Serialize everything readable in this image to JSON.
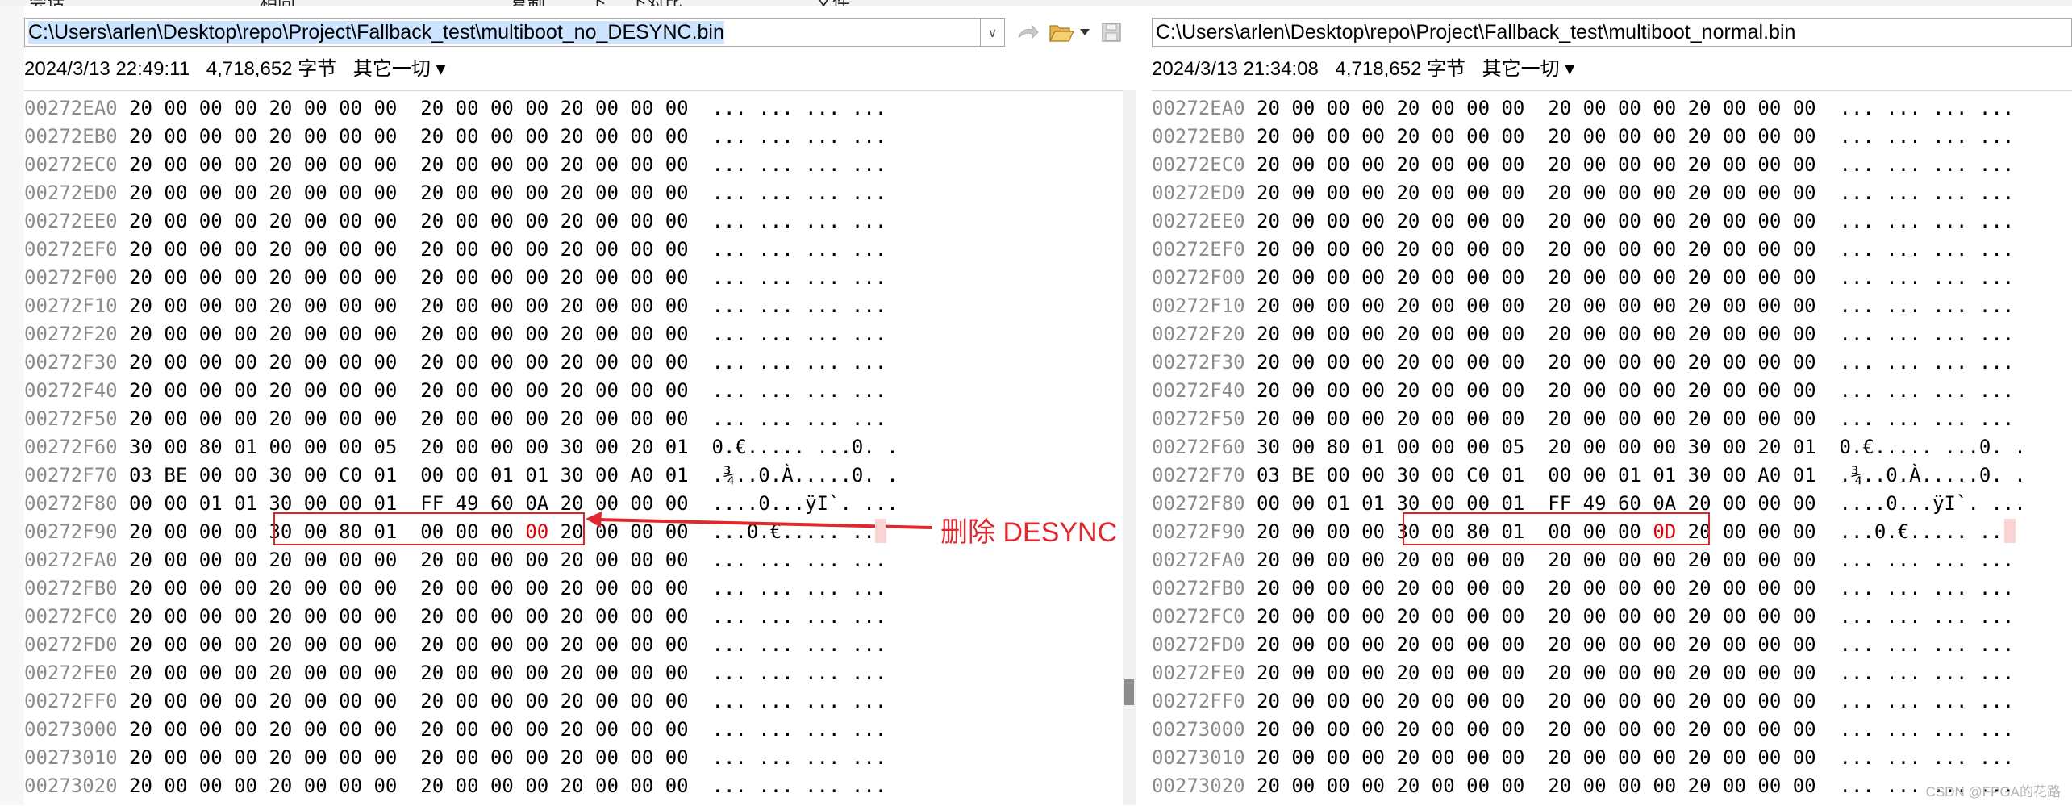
{
  "menu_fragments": [
    "会话",
    "相同",
    "复制",
    "下",
    "下对比",
    "文件"
  ],
  "left": {
    "path": "C:\\Users\\arlen\\Desktop\\repo\\Project\\Fallback_test\\multiboot_no_DESYNC.bin",
    "date": "2024/3/13 22:49:11",
    "size": "4,718,652 字节",
    "encoding": "其它一切 ▾"
  },
  "right": {
    "path": "C:\\Users\\arlen\\Desktop\\repo\\Project\\Fallback_test\\multiboot_normal.bin",
    "date": "2024/3/13 21:34:08",
    "size": "4,718,652 字节",
    "encoding": "其它一切 ▾"
  },
  "annotation": "删除 DESYNC",
  "watermark": "CSDN @FPGA的花路",
  "icons": {
    "dropdown": "chevron-down-icon",
    "copy": "copy-arrow-icon",
    "open": "folder-open-icon",
    "more": "caret-down-icon",
    "save": "save-disk-icon"
  },
  "colors": {
    "diff_text": "#e00000",
    "highlight_box": "#d9232a",
    "offset_text": "#8a8a8a",
    "annotation": "#e0282e"
  },
  "hex": {
    "left_rows": [
      {
        "off": "00272EA0",
        "bytes": "20 00 00 00 20 00 00 00  20 00 00 00 20 00 00 00",
        "ascii": "... ... ... ..."
      },
      {
        "off": "00272EB0",
        "bytes": "20 00 00 00 20 00 00 00  20 00 00 00 20 00 00 00",
        "ascii": "... ... ... ..."
      },
      {
        "off": "00272EC0",
        "bytes": "20 00 00 00 20 00 00 00  20 00 00 00 20 00 00 00",
        "ascii": "... ... ... ..."
      },
      {
        "off": "00272ED0",
        "bytes": "20 00 00 00 20 00 00 00  20 00 00 00 20 00 00 00",
        "ascii": "... ... ... ..."
      },
      {
        "off": "00272EE0",
        "bytes": "20 00 00 00 20 00 00 00  20 00 00 00 20 00 00 00",
        "ascii": "... ... ... ..."
      },
      {
        "off": "00272EF0",
        "bytes": "20 00 00 00 20 00 00 00  20 00 00 00 20 00 00 00",
        "ascii": "... ... ... ..."
      },
      {
        "off": "00272F00",
        "bytes": "20 00 00 00 20 00 00 00  20 00 00 00 20 00 00 00",
        "ascii": "... ... ... ..."
      },
      {
        "off": "00272F10",
        "bytes": "20 00 00 00 20 00 00 00  20 00 00 00 20 00 00 00",
        "ascii": "... ... ... ..."
      },
      {
        "off": "00272F20",
        "bytes": "20 00 00 00 20 00 00 00  20 00 00 00 20 00 00 00",
        "ascii": "... ... ... ..."
      },
      {
        "off": "00272F30",
        "bytes": "20 00 00 00 20 00 00 00  20 00 00 00 20 00 00 00",
        "ascii": "... ... ... ..."
      },
      {
        "off": "00272F40",
        "bytes": "20 00 00 00 20 00 00 00  20 00 00 00 20 00 00 00",
        "ascii": "... ... ... ..."
      },
      {
        "off": "00272F50",
        "bytes": "20 00 00 00 20 00 00 00  20 00 00 00 20 00 00 00",
        "ascii": "... ... ... ..."
      },
      {
        "off": "00272F60",
        "bytes": "30 00 80 01 00 00 00 05  20 00 00 00 30 00 20 01",
        "ascii": "0.€..... ...0. ."
      },
      {
        "off": "00272F70",
        "bytes": "03 BE 00 00 30 00 C0 01  00 00 01 01 30 00 A0 01",
        "ascii": ".¾..0.À.....0. ."
      },
      {
        "off": "00272F80",
        "bytes": "00 00 01 01 30 00 00 01  FF 49 60 0A 20 00 00 00",
        "ascii": "....0...ÿI`. ..."
      },
      {
        "off": "00272F90",
        "bytes_pre": "20 00 00 00 30 00 80 01  00 00 00 ",
        "bytes_diff": "00",
        "bytes_post": " 20 00 00 00",
        "ascii": "...0.€..... ..."
      },
      {
        "off": "00272FA0",
        "bytes": "20 00 00 00 20 00 00 00  20 00 00 00 20 00 00 00",
        "ascii": "... ... ... ..."
      },
      {
        "off": "00272FB0",
        "bytes": "20 00 00 00 20 00 00 00  20 00 00 00 20 00 00 00",
        "ascii": "... ... ... ..."
      },
      {
        "off": "00272FC0",
        "bytes": "20 00 00 00 20 00 00 00  20 00 00 00 20 00 00 00",
        "ascii": "... ... ... ..."
      },
      {
        "off": "00272FD0",
        "bytes": "20 00 00 00 20 00 00 00  20 00 00 00 20 00 00 00",
        "ascii": "... ... ... ..."
      },
      {
        "off": "00272FE0",
        "bytes": "20 00 00 00 20 00 00 00  20 00 00 00 20 00 00 00",
        "ascii": "... ... ... ..."
      },
      {
        "off": "00272FF0",
        "bytes": "20 00 00 00 20 00 00 00  20 00 00 00 20 00 00 00",
        "ascii": "... ... ... ..."
      },
      {
        "off": "00273000",
        "bytes": "20 00 00 00 20 00 00 00  20 00 00 00 20 00 00 00",
        "ascii": "... ... ... ..."
      },
      {
        "off": "00273010",
        "bytes": "20 00 00 00 20 00 00 00  20 00 00 00 20 00 00 00",
        "ascii": "... ... ... ..."
      },
      {
        "off": "00273020",
        "bytes": "20 00 00 00 20 00 00 00  20 00 00 00 20 00 00 00",
        "ascii": "... ... ... ..."
      }
    ],
    "right_rows": [
      {
        "off": "00272EA0",
        "bytes": "20 00 00 00 20 00 00 00  20 00 00 00 20 00 00 00",
        "ascii": "... ... ... ..."
      },
      {
        "off": "00272EB0",
        "bytes": "20 00 00 00 20 00 00 00  20 00 00 00 20 00 00 00",
        "ascii": "... ... ... ..."
      },
      {
        "off": "00272EC0",
        "bytes": "20 00 00 00 20 00 00 00  20 00 00 00 20 00 00 00",
        "ascii": "... ... ... ..."
      },
      {
        "off": "00272ED0",
        "bytes": "20 00 00 00 20 00 00 00  20 00 00 00 20 00 00 00",
        "ascii": "... ... ... ..."
      },
      {
        "off": "00272EE0",
        "bytes": "20 00 00 00 20 00 00 00  20 00 00 00 20 00 00 00",
        "ascii": "... ... ... ..."
      },
      {
        "off": "00272EF0",
        "bytes": "20 00 00 00 20 00 00 00  20 00 00 00 20 00 00 00",
        "ascii": "... ... ... ..."
      },
      {
        "off": "00272F00",
        "bytes": "20 00 00 00 20 00 00 00  20 00 00 00 20 00 00 00",
        "ascii": "... ... ... ..."
      },
      {
        "off": "00272F10",
        "bytes": "20 00 00 00 20 00 00 00  20 00 00 00 20 00 00 00",
        "ascii": "... ... ... ..."
      },
      {
        "off": "00272F20",
        "bytes": "20 00 00 00 20 00 00 00  20 00 00 00 20 00 00 00",
        "ascii": "... ... ... ..."
      },
      {
        "off": "00272F30",
        "bytes": "20 00 00 00 20 00 00 00  20 00 00 00 20 00 00 00",
        "ascii": "... ... ... ..."
      },
      {
        "off": "00272F40",
        "bytes": "20 00 00 00 20 00 00 00  20 00 00 00 20 00 00 00",
        "ascii": "... ... ... ..."
      },
      {
        "off": "00272F50",
        "bytes": "20 00 00 00 20 00 00 00  20 00 00 00 20 00 00 00",
        "ascii": "... ... ... ..."
      },
      {
        "off": "00272F60",
        "bytes": "30 00 80 01 00 00 00 05  20 00 00 00 30 00 20 01",
        "ascii": "0.€..... ...0. ."
      },
      {
        "off": "00272F70",
        "bytes": "03 BE 00 00 30 00 C0 01  00 00 01 01 30 00 A0 01",
        "ascii": ".¾..0.À.....0. ."
      },
      {
        "off": "00272F80",
        "bytes": "00 00 01 01 30 00 00 01  FF 49 60 0A 20 00 00 00",
        "ascii": "....0...ÿI`. ..."
      },
      {
        "off": "00272F90",
        "bytes_pre": "20 00 00 00 30 00 80 01  00 00 00 ",
        "bytes_diff": "0D",
        "bytes_post": " 20 00 00 00",
        "ascii": "...0.€..... ..."
      },
      {
        "off": "00272FA0",
        "bytes": "20 00 00 00 20 00 00 00  20 00 00 00 20 00 00 00",
        "ascii": "... ... ... ..."
      },
      {
        "off": "00272FB0",
        "bytes": "20 00 00 00 20 00 00 00  20 00 00 00 20 00 00 00",
        "ascii": "... ... ... ..."
      },
      {
        "off": "00272FC0",
        "bytes": "20 00 00 00 20 00 00 00  20 00 00 00 20 00 00 00",
        "ascii": "... ... ... ..."
      },
      {
        "off": "00272FD0",
        "bytes": "20 00 00 00 20 00 00 00  20 00 00 00 20 00 00 00",
        "ascii": "... ... ... ..."
      },
      {
        "off": "00272FE0",
        "bytes": "20 00 00 00 20 00 00 00  20 00 00 00 20 00 00 00",
        "ascii": "... ... ... ..."
      },
      {
        "off": "00272FF0",
        "bytes": "20 00 00 00 20 00 00 00  20 00 00 00 20 00 00 00",
        "ascii": "... ... ... ..."
      },
      {
        "off": "00273000",
        "bytes": "20 00 00 00 20 00 00 00  20 00 00 00 20 00 00 00",
        "ascii": "... ... ... ..."
      },
      {
        "off": "00273010",
        "bytes": "20 00 00 00 20 00 00 00  20 00 00 00 20 00 00 00",
        "ascii": "... ... ... ..."
      },
      {
        "off": "00273020",
        "bytes": "20 00 00 00 20 00 00 00  20 00 00 00 20 00 00 00",
        "ascii": "... ... ... ..."
      }
    ]
  }
}
